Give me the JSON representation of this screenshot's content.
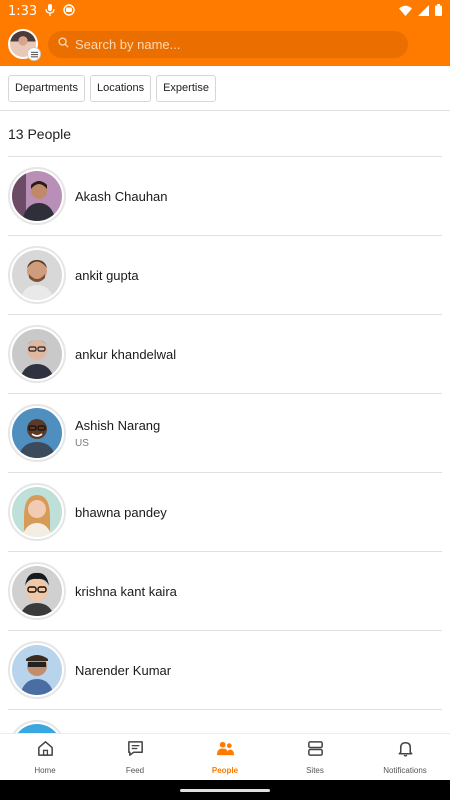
{
  "status_bar": {
    "time": "1:33"
  },
  "header": {
    "search_placeholder": "Search by name..."
  },
  "filters": [
    "Departments",
    "Locations",
    "Expertise"
  ],
  "people_count": "13 People",
  "people": [
    {
      "name": "Akash Chauhan",
      "location": ""
    },
    {
      "name": "ankit gupta",
      "location": ""
    },
    {
      "name": "ankur khandelwal",
      "location": ""
    },
    {
      "name": "Ashish Narang",
      "location": "US"
    },
    {
      "name": "bhawna pandey",
      "location": ""
    },
    {
      "name": "krishna kant kaira",
      "location": ""
    },
    {
      "name": "Narender Kumar",
      "location": ""
    }
  ],
  "nav": [
    {
      "label": "Home",
      "icon": "home-icon"
    },
    {
      "label": "Feed",
      "icon": "feed-icon"
    },
    {
      "label": "People",
      "icon": "people-icon",
      "active": true
    },
    {
      "label": "Sites",
      "icon": "sites-icon"
    },
    {
      "label": "Notifications",
      "icon": "bell-icon"
    }
  ],
  "colors": {
    "accent": "#ff7b00",
    "search_bg": "#ea6f00"
  }
}
